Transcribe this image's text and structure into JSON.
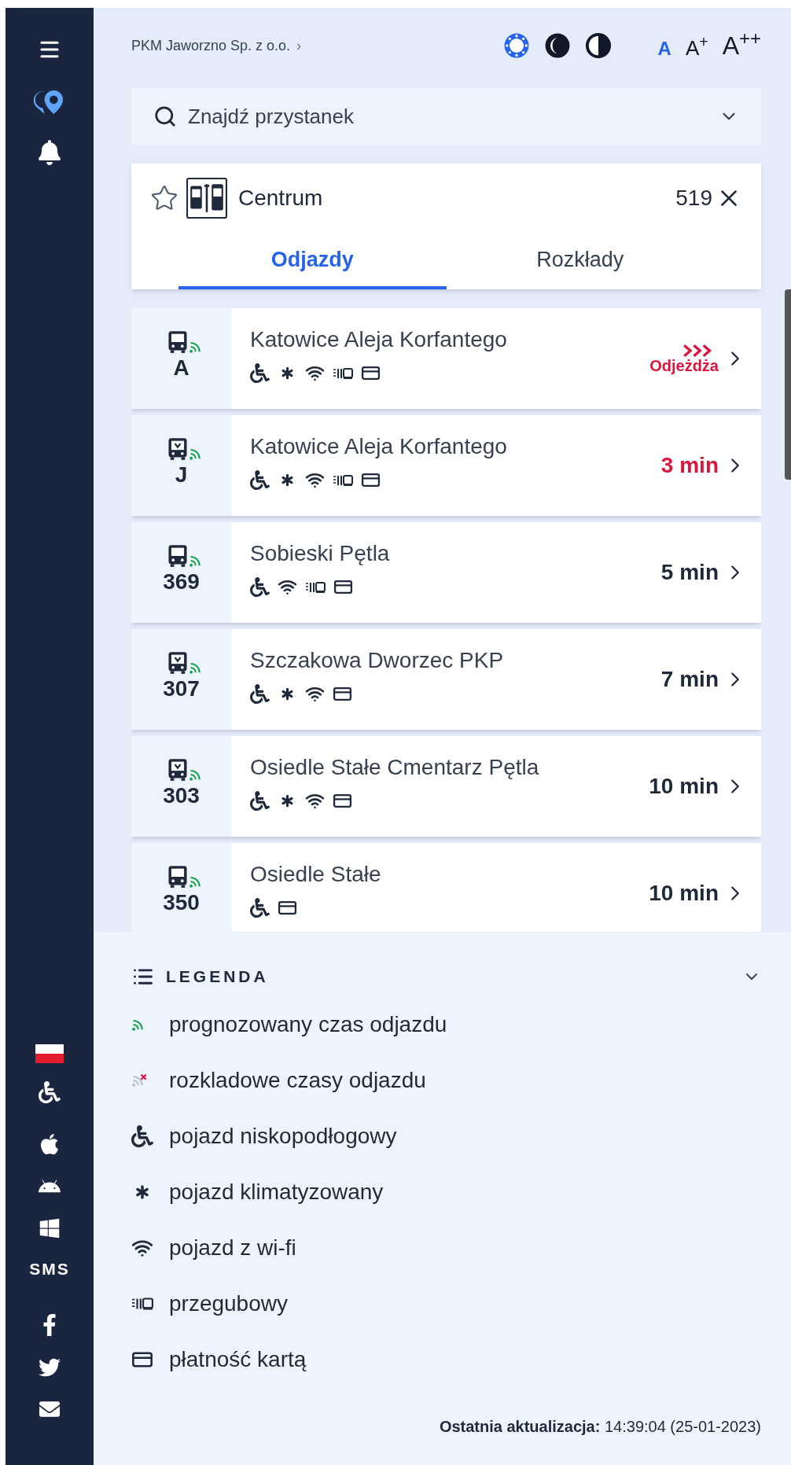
{
  "sidebar": {
    "sms_label": "SMS"
  },
  "header": {
    "operator": "PKM Jaworzno Sp. z o.o.",
    "operator_chevron": "›",
    "contrast_modes": [
      {
        "kind": "default",
        "selected": true
      },
      {
        "kind": "dark",
        "selected": false
      },
      {
        "kind": "high",
        "selected": false
      }
    ],
    "font_sizes": [
      {
        "label": "A",
        "selected": true
      },
      {
        "label": "A$^{+}$",
        "selected": false
      },
      {
        "label": "A$^{++}$",
        "selected": false
      }
    ]
  },
  "search": {
    "placeholder": "Znajdź przystanek"
  },
  "stop": {
    "favorite": false,
    "name": "Centrum",
    "number": "519",
    "tabs": [
      {
        "label": "Odjazdy",
        "selected": true
      },
      {
        "label": "Rozkłady",
        "selected": false
      }
    ]
  },
  "departures": [
    {
      "vehicle": {
        "kind": "bus"
      },
      "realtime": true,
      "line": "A",
      "destination": "Katowice Aleja Korfantego",
      "features": [
        {
          "kind": "wheelchair"
        },
        {
          "kind": "ac"
        },
        {
          "kind": "wifi"
        },
        {
          "kind": "articulated"
        },
        {
          "kind": "card"
        }
      ],
      "time": {
        "kind": "departing",
        "text": "Odjeżdża"
      }
    },
    {
      "vehicle": {
        "kind": "tram"
      },
      "realtime": true,
      "line": "J",
      "destination": "Katowice Aleja Korfantego",
      "features": [
        {
          "kind": "wheelchair"
        },
        {
          "kind": "ac"
        },
        {
          "kind": "wifi"
        },
        {
          "kind": "articulated"
        },
        {
          "kind": "card"
        }
      ],
      "time": {
        "kind": "soon",
        "text": "3 min"
      }
    },
    {
      "vehicle": {
        "kind": "bus"
      },
      "realtime": true,
      "line": "369",
      "destination": "Sobieski Pętla",
      "features": [
        {
          "kind": "wheelchair"
        },
        {
          "kind": "wifi"
        },
        {
          "kind": "articulated"
        },
        {
          "kind": "card"
        }
      ],
      "time": {
        "kind": "normal",
        "text": "5 min"
      }
    },
    {
      "vehicle": {
        "kind": "tram"
      },
      "realtime": true,
      "line": "307",
      "destination": "Szczakowa Dworzec PKP",
      "features": [
        {
          "kind": "wheelchair"
        },
        {
          "kind": "ac"
        },
        {
          "kind": "wifi"
        },
        {
          "kind": "card"
        }
      ],
      "time": {
        "kind": "normal",
        "text": "7 min"
      }
    },
    {
      "vehicle": {
        "kind": "tram"
      },
      "realtime": true,
      "line": "303",
      "destination": "Osiedle Stałe Cmentarz Pętla",
      "features": [
        {
          "kind": "wheelchair"
        },
        {
          "kind": "ac"
        },
        {
          "kind": "wifi"
        },
        {
          "kind": "card"
        }
      ],
      "time": {
        "kind": "normal",
        "text": "10 min"
      }
    },
    {
      "vehicle": {
        "kind": "bus"
      },
      "realtime": true,
      "line": "350",
      "destination": "Osiedle Stałe",
      "features": [
        {
          "kind": "wheelchair"
        },
        {
          "kind": "card"
        }
      ],
      "time": {
        "kind": "normal",
        "text": "10 min"
      }
    }
  ],
  "legend": {
    "title": "LEGENDA",
    "items": [
      {
        "kind": "realtime",
        "text": "prognozowany czas odjazdu"
      },
      {
        "kind": "scheduled",
        "text": "rozkladowe czasy odjazdu"
      },
      {
        "kind": "wheelchair",
        "text": "pojazd niskopodłogowy"
      },
      {
        "kind": "ac",
        "text": "pojazd klimatyzowany"
      },
      {
        "kind": "wifi",
        "text": "pojazd z wi-fi"
      },
      {
        "kind": "articulated",
        "text": "przegubowy"
      },
      {
        "kind": "card",
        "text": "płatność kartą"
      }
    ]
  },
  "footer": {
    "last_update": "**Ostatnia aktualizacja:** 14:39:04 (25-01-2023)"
  }
}
